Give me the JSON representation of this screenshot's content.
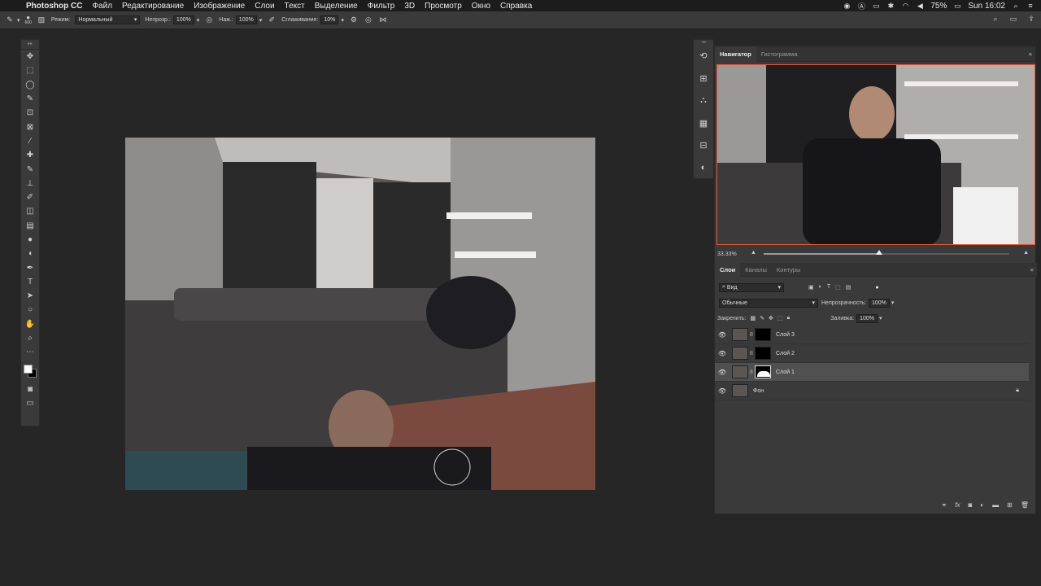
{
  "menubar": {
    "app": "Photoshop CC",
    "items": [
      "Файл",
      "Редактирование",
      "Изображение",
      "Слои",
      "Текст",
      "Выделение",
      "Фильтр",
      "3D",
      "Просмотр",
      "Окно",
      "Справка"
    ],
    "battery": "75%",
    "clock": "Sun 16:02"
  },
  "options": {
    "brush_size": "600",
    "mode_label": "Режим:",
    "mode_value": "Нормальный",
    "opacity_label": "Непрозр.:",
    "opacity_value": "100%",
    "pressure_label": "Наж.:",
    "pressure_value": "100%",
    "smoothing_label": "Сглаживание:",
    "smoothing_value": "10%"
  },
  "tools": [
    "move-icon",
    "marquee-icon",
    "lasso-icon",
    "quick-select-icon",
    "crop-icon",
    "frame-icon",
    "eyedropper-icon",
    "healing-icon",
    "brush-icon",
    "stamp-icon",
    "history-brush-icon",
    "eraser-icon",
    "gradient-icon",
    "blur-icon",
    "dodge-icon",
    "pen-icon",
    "type-icon",
    "path-select-icon",
    "shape-icon",
    "hand-icon",
    "zoom-icon",
    "more-icon"
  ],
  "navigator": {
    "tab_active": "Навигатор",
    "tab_other": "Гистограмма",
    "zoom": "33.33%",
    "zoom_fraction": 0.47
  },
  "layers_panel": {
    "tabs": [
      "Слои",
      "Каналы",
      "Контуры"
    ],
    "filter_label": "Вид",
    "blend_mode": "Обычные",
    "opacity_label": "Непрозрачность:",
    "opacity_value": "100%",
    "lock_label": "Закрепить:",
    "fill_label": "Заливка:",
    "fill_value": "100%",
    "layers": [
      {
        "name": "Слой 3",
        "selected": false,
        "mask": "black"
      },
      {
        "name": "Слой 2",
        "selected": false,
        "mask": "black"
      },
      {
        "name": "Слой 1",
        "selected": true,
        "mask": "white-shape"
      },
      {
        "name": "Фон",
        "selected": false,
        "mask": "none"
      }
    ]
  },
  "colors": {
    "foreground": "#ffffff",
    "background": "#000000",
    "ui_dark": "#262626",
    "panel": "#3a3a3a"
  }
}
